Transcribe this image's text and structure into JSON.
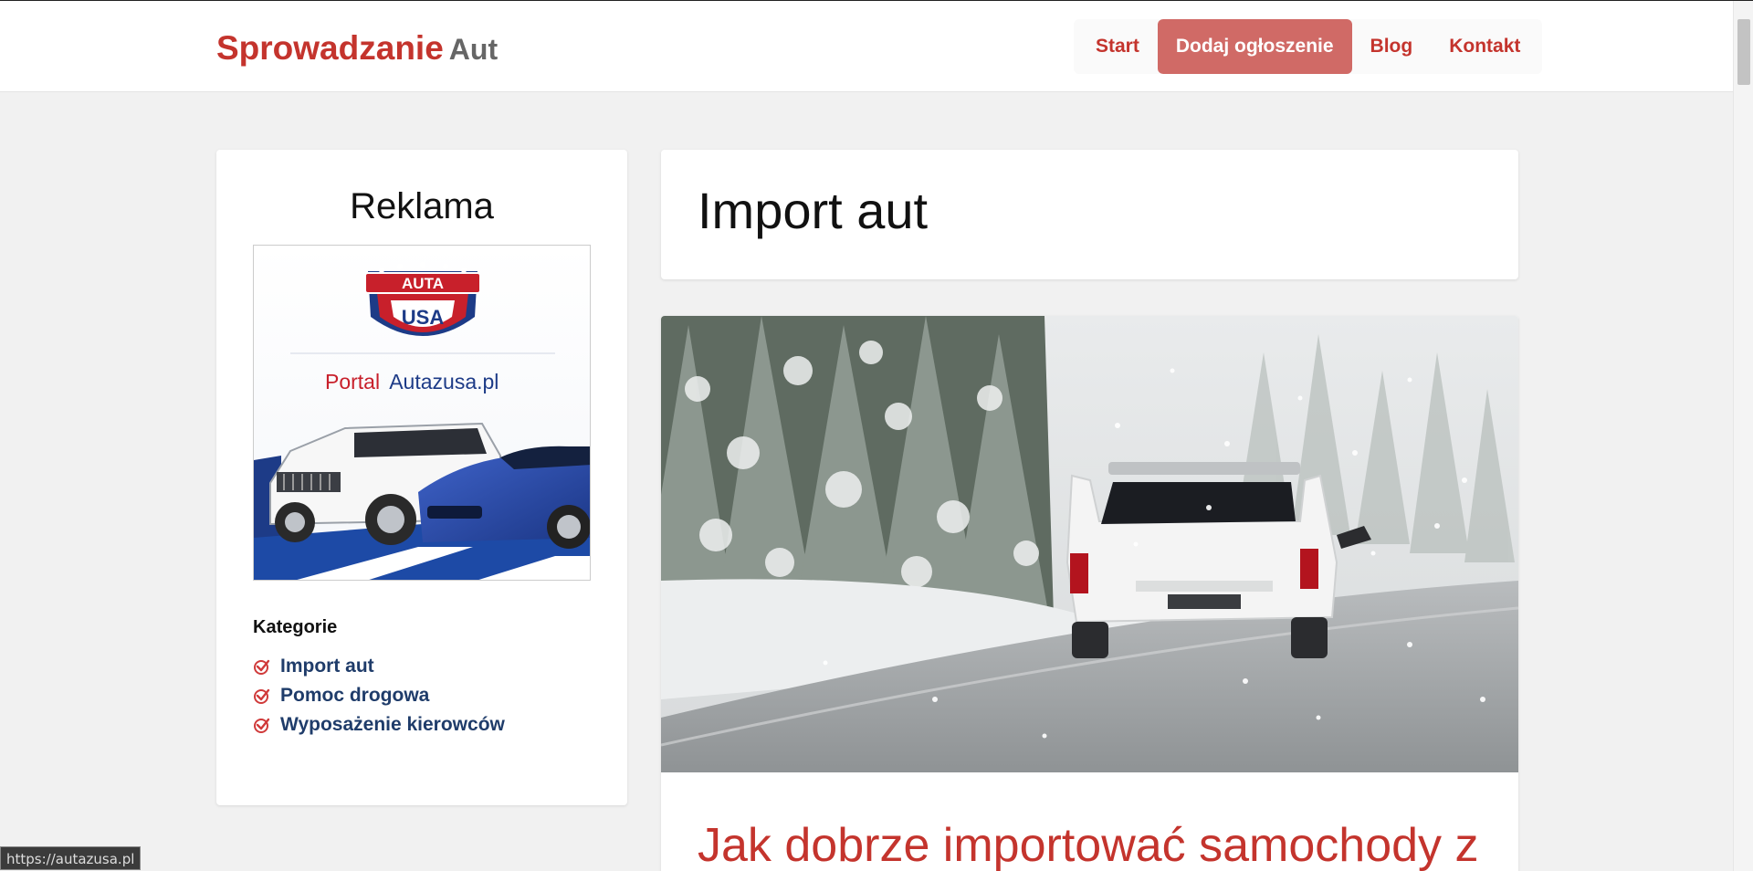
{
  "header": {
    "brand_main": "Sprowadzanie",
    "brand_sub": "Aut",
    "nav": [
      {
        "label": "Start"
      },
      {
        "label": "Dodaj ogłoszenie"
      },
      {
        "label": "Blog"
      },
      {
        "label": "Kontakt"
      }
    ]
  },
  "sidebar": {
    "ad_title": "Reklama",
    "ad_banner": {
      "portal_word": "Portal",
      "portal_name": "Autazusa.pl",
      "badge_top": "AUTA",
      "badge_bottom": "USA"
    },
    "categories_title": "Kategorie",
    "categories": [
      {
        "label": "Import aut"
      },
      {
        "label": "Pomoc drogowa"
      },
      {
        "label": "Wyposażenie kierowców"
      }
    ]
  },
  "main": {
    "page_title": "Import aut",
    "article_title": "Jak dobrze importować samochody z"
  },
  "status_url": "https://autazusa.pl",
  "colors": {
    "accent": "#c4342d",
    "nav_active_bg": "#d06a66",
    "category_link": "#1f3c6a",
    "page_bg": "#f1f1f1"
  }
}
